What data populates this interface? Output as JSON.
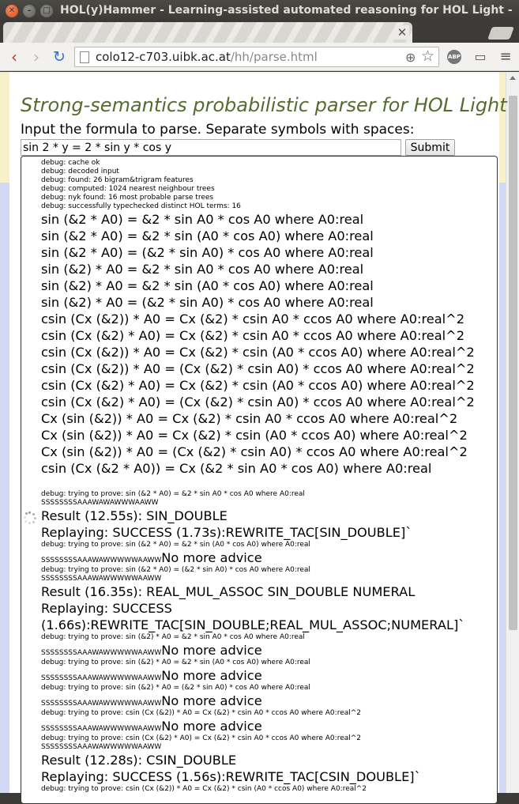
{
  "browser": {
    "window_title": "HOL(y)Hammer - Learning-assisted automated reasoning for HOL Light - Chrome",
    "url_host": "colo12-c703.uibk.ac.at",
    "url_path": "/hh/parse.html",
    "adblock_label": "ABP",
    "icons": {
      "back": "back-arrow-icon",
      "forward": "forward-arrow-icon",
      "reload": "reload-icon",
      "zoom": "zoom-icon",
      "bookmark": "star-icon",
      "cast": "cast-icon",
      "menu": "hamburger-menu-icon"
    }
  },
  "page": {
    "heading": "Strong-semantics probabilistic parser for HOL Light",
    "instruction": "Input the formula to parse. Separate symbols with spaces:",
    "formula_value": "sin 2 * y = 2 * sin y * cos y",
    "submit_label": "Submit",
    "colors": {
      "heading": "#556b2f",
      "left_strip_top": "#f8f0c8",
      "left_strip_bottom": "#d3d9f5"
    }
  },
  "output": {
    "debug": [
      "debug: cache ok",
      "debug: decoded input",
      "debug: found: 26 bigram&trigram features",
      "debug: computed: 1024 nearest neighbour trees",
      "debug: nyk found: 16 most probable parse trees",
      "debug: successfully typechecked distinct HOL terms: 16"
    ],
    "terms": [
      "sin (&2 * A0) = &2 * sin A0 * cos A0 where A0:real",
      "sin (&2 * A0) = &2 * sin (A0 * cos A0) where A0:real",
      "sin (&2 * A0) = (&2 * sin A0) * cos A0 where A0:real",
      "sin (&2) * A0 = &2 * sin A0 * cos A0 where A0:real",
      "sin (&2) * A0 = &2 * sin (A0 * cos A0) where A0:real",
      "sin (&2) * A0 = (&2 * sin A0) * cos A0 where A0:real",
      "csin (Cx (&2)) * A0 = Cx (&2) * csin A0 * ccos A0 where A0:real^2",
      "csin (Cx (&2) * A0) = Cx (&2) * csin A0 * ccos A0 where A0:real^2",
      "csin (Cx (&2)) * A0 = Cx (&2) * csin (A0 * ccos A0) where A0:real^2",
      "csin (Cx (&2)) * A0 = (Cx (&2) * csin A0) * ccos A0 where A0:real^2",
      "csin (Cx (&2) * A0) = Cx (&2) * csin (A0 * ccos A0) where A0:real^2",
      "csin (Cx (&2) * A0) = (Cx (&2) * csin A0) * ccos A0 where A0:real^2",
      "Cx (sin (&2)) * A0 = Cx (&2) * csin A0 * ccos A0 where A0:real^2",
      "Cx (sin (&2)) * A0 = Cx (&2) * csin (A0 * ccos A0) where A0:real^2",
      "Cx (sin (&2)) * A0 = (Cx (&2) * csin A0) * ccos A0 where A0:real^2",
      "csin (Cx (&2 * A0)) = Cx (&2 * sin A0 * cos A0) where A0:real"
    ],
    "proofs": {
      "p1_debug": "debug: trying to prove: sin (&2 * A0) = &2 * sin A0 * cos A0 where A0:real",
      "p1_code": "SSSSSSSSAAAWAWAWWWAAWW",
      "p1_result": "Result (12.55s): SIN_DOUBLE",
      "p1_replay": "Replaying: SUCCESS (1.73s):REWRITE_TAC[SIN_DOUBLE]`",
      "p2_debug": "debug: trying to prove: sin (&2 * A0) = &2 * sin (A0 * cos A0) where A0:real",
      "p2_code": "SSSSSSSSAAAWAWWWWWAAWW",
      "p2_msg": "No more advice",
      "p3_debug": "debug: trying to prove: sin (&2 * A0) = (&2 * sin A0) * cos A0 where A0:real",
      "p3_code": "SSSSSSSSAAAWAWWWWWAAWW",
      "p3_result": "Result (16.35s): REAL_MUL_ASSOC SIN_DOUBLE NUMERAL",
      "p3_replay_1": "Replaying: SUCCESS",
      "p3_replay_2": "(1.66s):REWRITE_TAC[SIN_DOUBLE;REAL_MUL_ASSOC;NUMERAL]`",
      "p4_debug": "debug: trying to prove: sin (&2) * A0 = &2 * sin A0 * cos A0 where A0:real",
      "p4_code": "SSSSSSSSAAAWAWWWWWAAWW",
      "p4_msg": "No more advice",
      "p5_debug": "debug: trying to prove: sin (&2) * A0 = &2 * sin (A0 * cos A0) where A0:real",
      "p5_code": "SSSSSSSSAAAWAWWWWWAAWW",
      "p5_msg": "No more advice",
      "p6_debug": "debug: trying to prove: sin (&2) * A0 = (&2 * sin A0) * cos A0 where A0:real",
      "p6_code": "SSSSSSSSAAAWAWWWWWAAWW",
      "p6_msg": "No more advice",
      "p7_debug": "debug: trying to prove: csin (Cx (&2)) * A0 = Cx (&2) * csin A0 * ccos A0 where A0:real^2",
      "p7_code": "SSSSSSSSAAAWAWWWWWAAWW",
      "p7_msg": "No more advice",
      "p8_debug": "debug: trying to prove: csin (Cx (&2) * A0) = Cx (&2) * csin A0 * ccos A0 where A0:real^2",
      "p8_code": "SSSSSSSSAAAWAWWWWWAAWW",
      "p8_result": "Result (12.28s): CSIN_DOUBLE",
      "p8_replay": "Replaying: SUCCESS (1.56s):REWRITE_TAC[CSIN_DOUBLE]`",
      "p9_debug": "debug: trying to prove: csin (Cx (&2)) * A0 = Cx (&2) * csin (A0 * ccos A0) where A0:real^2"
    }
  }
}
